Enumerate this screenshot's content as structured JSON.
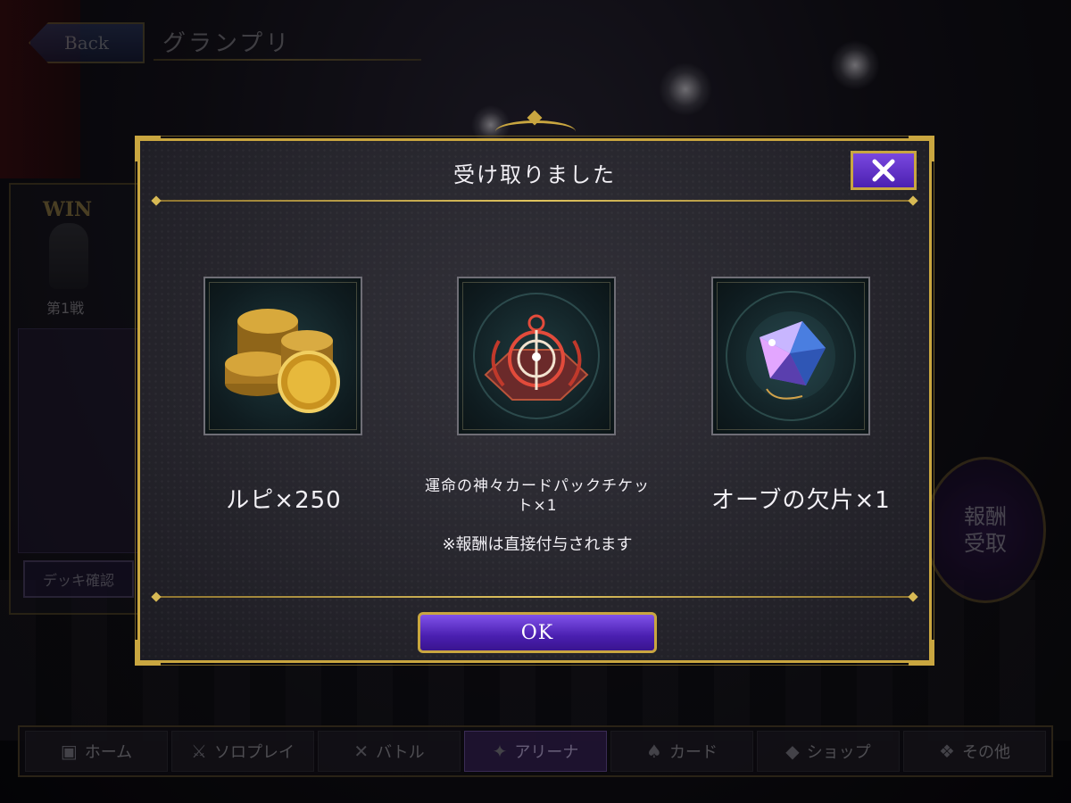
{
  "background": {
    "back_label": "Back",
    "page_title": "グランプリ",
    "win_label": "WIN",
    "round_label": "第1戦",
    "deck_button": "デッキ確認",
    "reward_button_line1": "報酬",
    "reward_button_line2": "受取"
  },
  "modal": {
    "title": "受け取りました",
    "close_icon": "close-x-icon",
    "rewards": [
      {
        "name": "ルピ×250",
        "icon": "gold-coins-icon"
      },
      {
        "name": "運命の神々カードパックチケット×1",
        "icon": "card-pack-ticket-icon"
      },
      {
        "name": "オーブの欠片×1",
        "icon": "orb-shard-gem-icon"
      }
    ],
    "note": "※報酬は直接付与されます",
    "ok_label": "OK"
  },
  "nav": {
    "items": [
      {
        "label": "ホーム",
        "icon": "home-icon"
      },
      {
        "label": "ソロプレイ",
        "icon": "sword-shield-icon"
      },
      {
        "label": "バトル",
        "icon": "crossed-swords-icon"
      },
      {
        "label": "アリーナ",
        "icon": "arena-icon"
      },
      {
        "label": "カード",
        "icon": "cards-icon"
      },
      {
        "label": "ショップ",
        "icon": "shop-icon"
      },
      {
        "label": "その他",
        "icon": "other-icon"
      }
    ]
  },
  "colors": {
    "gold": "#c9a640",
    "purple_button": "#5a2bc8",
    "panel": "#2a2930"
  }
}
